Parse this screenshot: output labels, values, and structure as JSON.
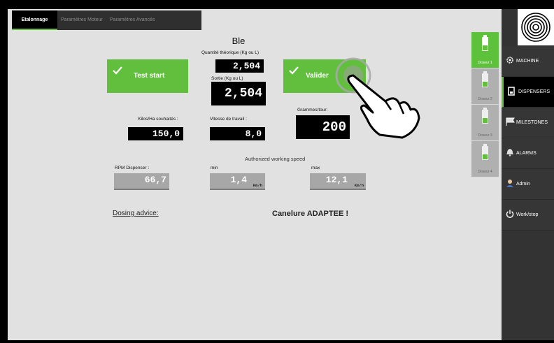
{
  "tabs": [
    {
      "label": "Etalonnage",
      "active": true
    },
    {
      "label": "Paramètres Moteur",
      "active": false
    },
    {
      "label": "Paramètres Avancés",
      "active": false
    }
  ],
  "product": "Ble",
  "quantite": {
    "label": "Quantité théorique (Kg ou L)",
    "value": "2,504"
  },
  "sortie": {
    "label": "Sortie (Kg ou L)",
    "value": "2,504"
  },
  "buttons": {
    "test_start": "Test start",
    "valider": "Valider"
  },
  "kilos": {
    "label": "Kilos/Ha souhaités :",
    "value": "150,0"
  },
  "vitesse": {
    "label": "Vitesse de travail :",
    "value": "8,0"
  },
  "grammes": {
    "label": "Grammes/tour:",
    "value": "200"
  },
  "authorized": {
    "label": "Authorized working speed",
    "rpm": {
      "label": "RPM Dispenser :",
      "value": "66,7"
    },
    "min": {
      "label": "min",
      "value": "1,4",
      "unit": "Km/h"
    },
    "max": {
      "label": "max",
      "value": "12,1",
      "unit": "Km/h"
    }
  },
  "dosing": {
    "label": "Dosing advice:",
    "value": "Canelure ADAPTEE !"
  },
  "doseurs": [
    {
      "label": "Doseur 1",
      "active": true
    },
    {
      "label": "Doseur 2",
      "active": false
    },
    {
      "label": "Doseur 3",
      "active": false
    },
    {
      "label": "Doseur 4",
      "active": false
    }
  ],
  "sidebar": {
    "logo_icon": "fingerprint-icon",
    "items": [
      {
        "label": "MACHINE",
        "icon": "gear-icon",
        "active": false
      },
      {
        "label": "DISPENSERS",
        "icon": "dispenser-icon",
        "active": true
      },
      {
        "label": "MILESTONES",
        "icon": "flag-icon",
        "active": false
      },
      {
        "label": "ALARMS",
        "icon": "bell-icon",
        "active": false
      },
      {
        "label": "Admin",
        "icon": "user-icon",
        "active": false
      },
      {
        "label": "Work/stop",
        "icon": "power-icon",
        "active": false
      }
    ]
  },
  "colors": {
    "accent": "#62bf3e",
    "sidebar": "#333333",
    "panel": "#e1e1e1"
  }
}
